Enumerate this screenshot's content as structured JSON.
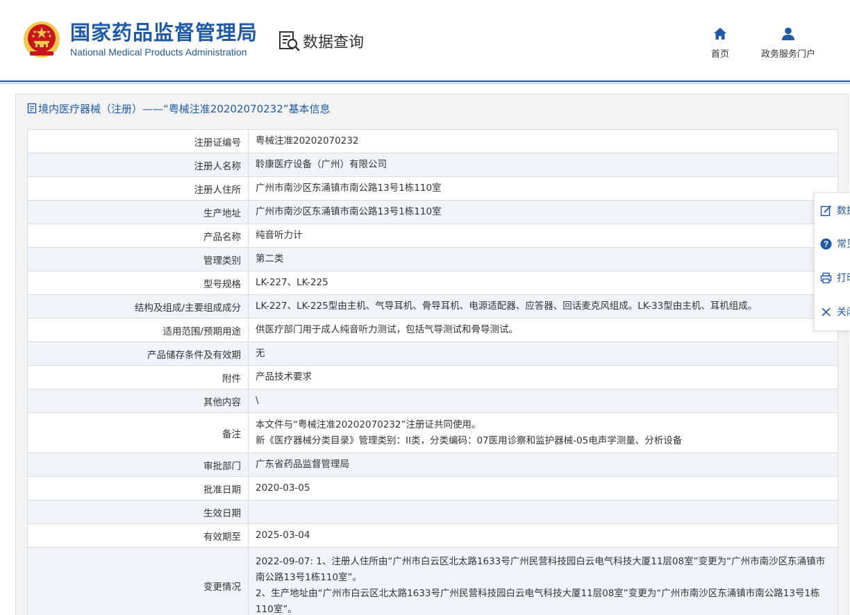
{
  "header": {
    "site_name_cn": "国家药品监督管理局",
    "site_name_en": "National Medical Products Administration",
    "section_title": "数据查询",
    "nav": [
      {
        "label": "首页",
        "icon": "home-icon"
      },
      {
        "label": "政务服务门户",
        "icon": "user-icon"
      }
    ]
  },
  "panel": {
    "title": "境内医疗器械（注册）——“粤械注准20202070232”基本信息"
  },
  "table": {
    "rows": [
      {
        "label": "注册证编号",
        "value": "粤械注准20202070232"
      },
      {
        "label": "注册人名称",
        "value": "聆康医疗设备（广州）有限公司"
      },
      {
        "label": "注册人住所",
        "value": "广州市南沙区东涌镇市南公路13号1栋110室"
      },
      {
        "label": "生产地址",
        "value": "广州市南沙区东涌镇市南公路13号1栋110室"
      },
      {
        "label": "产品名称",
        "value": "纯音听力计"
      },
      {
        "label": "管理类别",
        "value": "第二类"
      },
      {
        "label": "型号规格",
        "value": "LK-227、LK-225"
      },
      {
        "label": "结构及组成/主要组成成分",
        "value": "LK-227、LK-225型由主机、气导耳机、骨导耳机、电源适配器、应答器、回话麦克风组成。LK-33型由主机、耳机组成。"
      },
      {
        "label": "适用范围/预期用途",
        "value": "供医疗部门用于成人纯音听力测试，包括气导测试和骨导测试。"
      },
      {
        "label": "产品储存条件及有效期",
        "value": "无"
      },
      {
        "label": "附件",
        "value": "产品技术要求"
      },
      {
        "label": "其他内容",
        "value": "\\"
      },
      {
        "label": "备注",
        "lines": [
          "本文件与“粤械注准20202070232”注册证共同使用。",
          "新《医疗器械分类目录》管理类别：II类，分类编码：07医用诊察和监护器械-05电声学测量、分析设备"
        ]
      },
      {
        "label": "审批部门",
        "value": "广东省药品监督管理局"
      },
      {
        "label": "批准日期",
        "value": "2020-03-05"
      },
      {
        "label": "生效日期",
        "value": ""
      },
      {
        "label": "有效期至",
        "value": "2025-03-04"
      },
      {
        "label": "变更情况",
        "lines": [
          "2022-09-07: 1、注册人住所由“广州市白云区北太路1633号广州民营科技园白云电气科技大厦11层08室”变更为“广州市南沙区东涌镇市南公路13号1栋110室”。",
          "2、生产地址由“广州市白云区北太路1633号广州民营科技园白云电气科技大厦11层08室”变更为“广州市南沙区东涌镇市南公路13号1栋110室”。"
        ]
      }
    ]
  },
  "side_toolbar": [
    {
      "label": "数据",
      "icon": "edit-icon"
    },
    {
      "label": "常见",
      "icon": "help-icon"
    },
    {
      "label": "打印",
      "icon": "print-icon"
    },
    {
      "label": "关闭",
      "icon": "close-icon"
    }
  ],
  "colors": {
    "brand_blue": "#1f5aa8",
    "emblem_red": "#c8161d",
    "emblem_gold": "#f2c94c",
    "row_alt": "#f1f3f9"
  }
}
